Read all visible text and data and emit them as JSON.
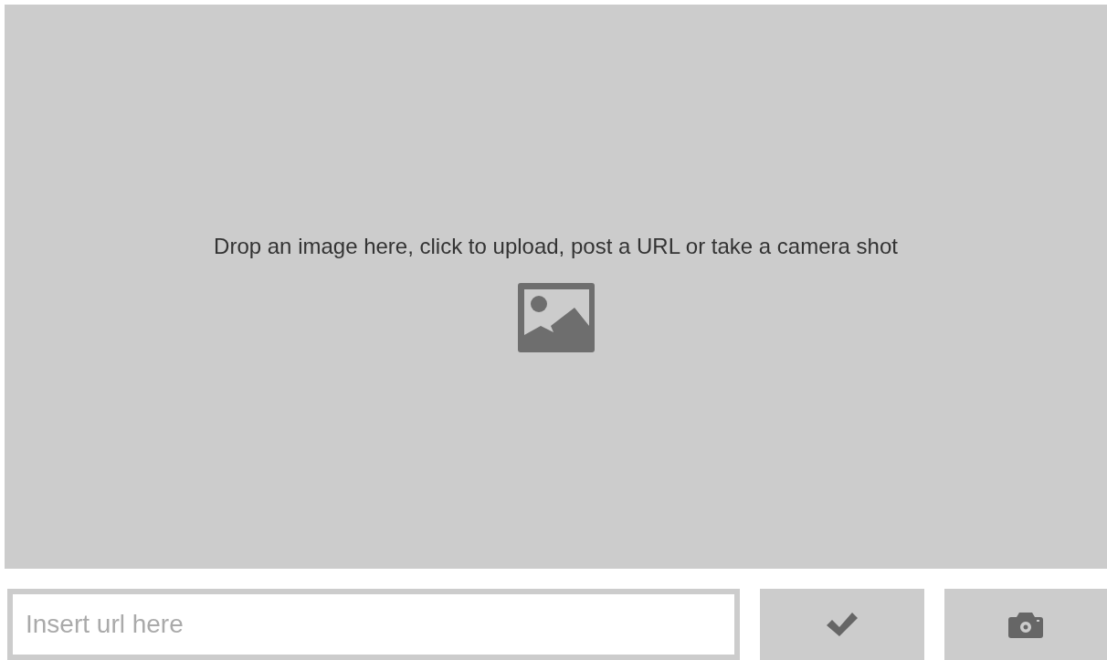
{
  "dropzone": {
    "message": "Drop an image here, click to upload, post a URL or take a camera shot"
  },
  "url_field": {
    "placeholder": "Insert url here"
  }
}
